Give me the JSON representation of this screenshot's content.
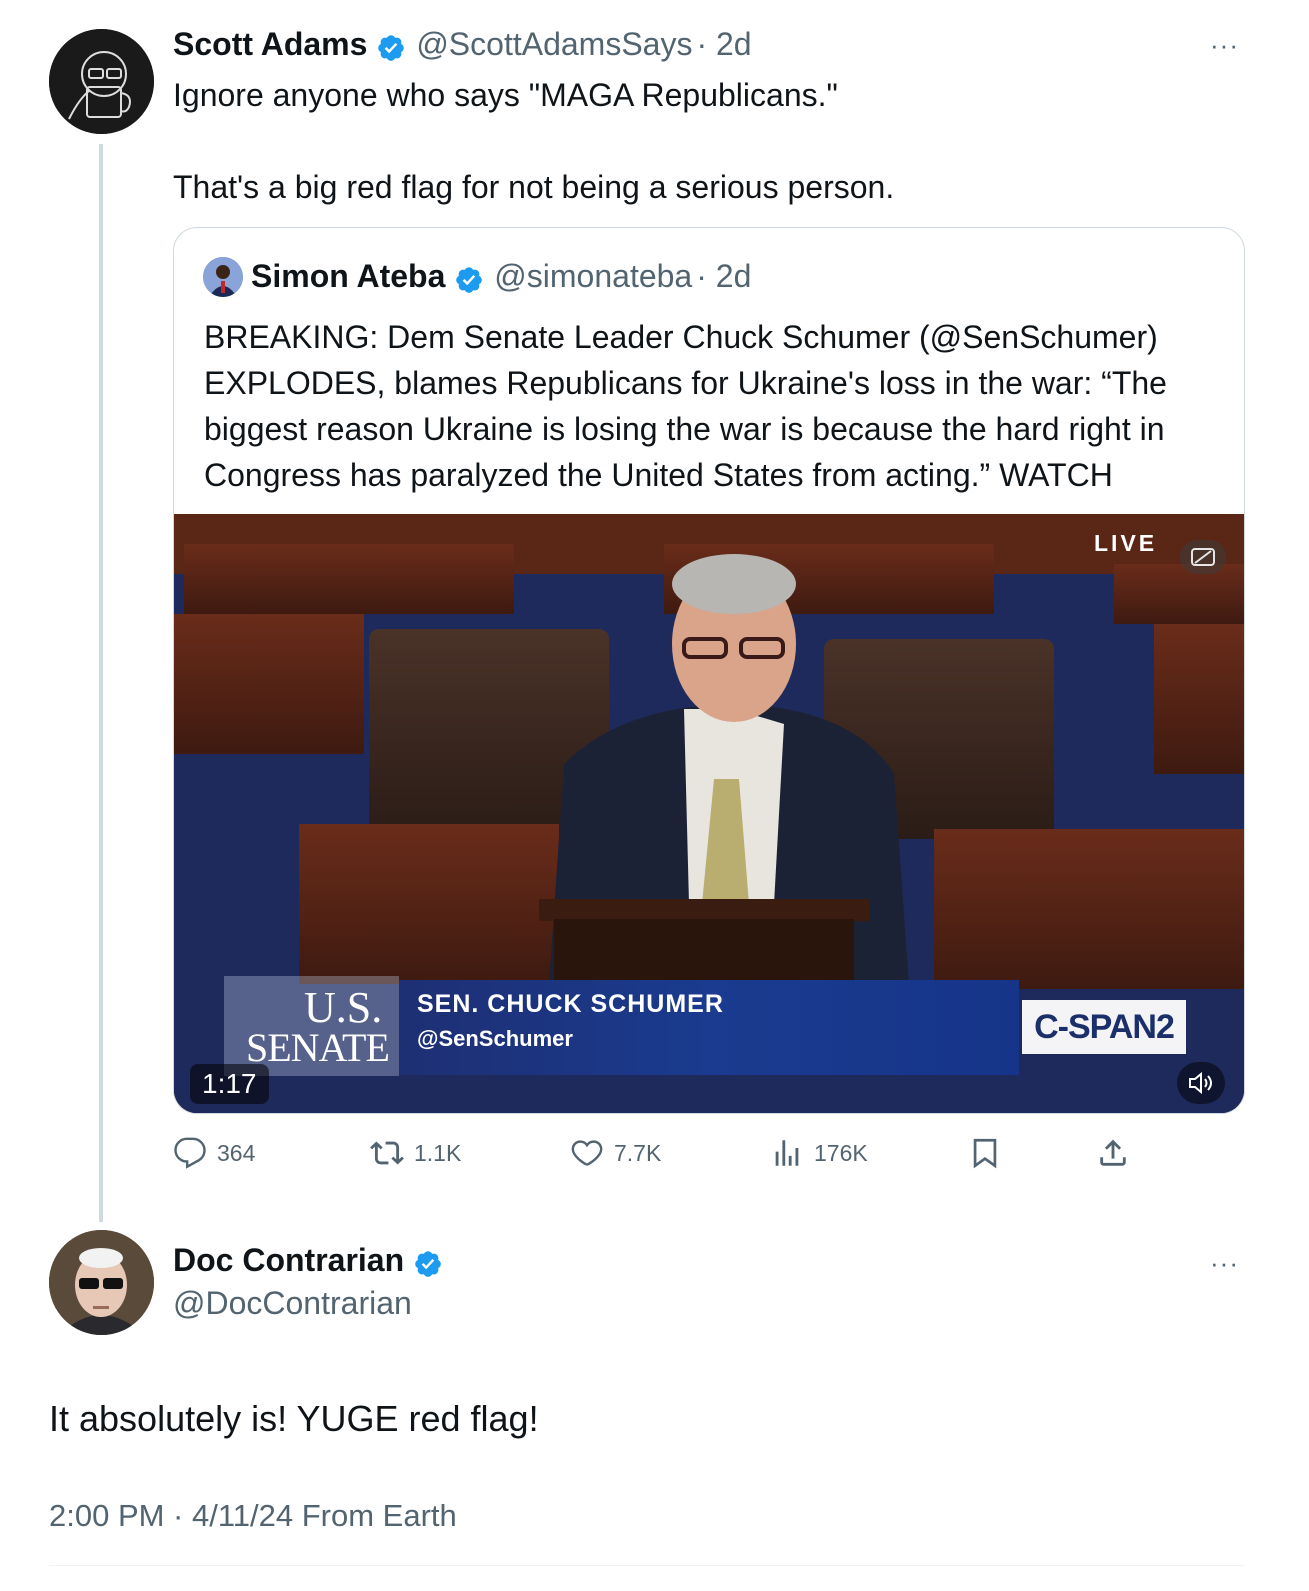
{
  "tweet": {
    "author_name": "Scott Adams",
    "author_handle": "@ScottAdamsSays",
    "time": "· 2d",
    "text_line1": "Ignore anyone who says \"MAGA Republicans.\"",
    "text_line2": "That's a big red flag for not being a serious person.",
    "more": "···"
  },
  "quote": {
    "author_name": "Simon Ateba",
    "author_handle": "@simonateba",
    "time": "· 2d",
    "lines": [
      "BREAKING: Dem Senate Leader Chuck Schumer (@SenSchumer)",
      "EXPLODES, blames Republicans for Ukraine's loss in the war: “The",
      "biggest reason Ukraine is losing the war is because the hard right in",
      "Congress has paralyzed the United States from acting.” WATCH"
    ],
    "video": {
      "live_label": "LIVE",
      "senate_logo_line1": "U.S.",
      "senate_logo_line2": "SENATE",
      "chyron_name": "SEN. CHUCK SCHUMER",
      "chyron_handle": "@SenSchumer",
      "network": "C-SPAN2",
      "duration": "1:17"
    }
  },
  "actions": {
    "replies": "364",
    "reposts": "1.1K",
    "likes": "7.7K",
    "views": "176K"
  },
  "reply": {
    "author_name": "Doc Contrarian",
    "author_handle": "@DocContrarian",
    "text": "It absolutely is! YUGE red flag!",
    "timestamp": "2:00 PM · 4/11/24 From Earth",
    "more": "···"
  },
  "colors": {
    "verified": "#1d9bf0",
    "secondary_text": "#536471",
    "border": "#cfd9de"
  }
}
